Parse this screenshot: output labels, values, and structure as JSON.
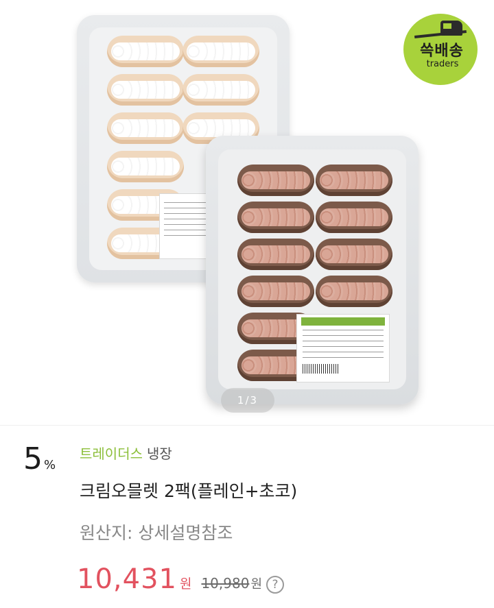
{
  "logo": {
    "brand_korean": "쓱배송",
    "brand_latin": "traders"
  },
  "gallery": {
    "pager": "1/3"
  },
  "product": {
    "discount_value": "5",
    "discount_unit": "%",
    "brand": "트레이더스",
    "storage": "냉장",
    "title": "크림오믈렛 2팩(플레인+초코)",
    "origin": "원산지: 상세설명참조",
    "price": "10,431",
    "price_unit": "원",
    "original_price": "10,980",
    "original_price_unit": "원",
    "help_icon_glyph": "?"
  },
  "colors": {
    "brand_green": "#8cbf3a",
    "price_red": "#e2525f",
    "logo_green": "#a8d23b"
  }
}
